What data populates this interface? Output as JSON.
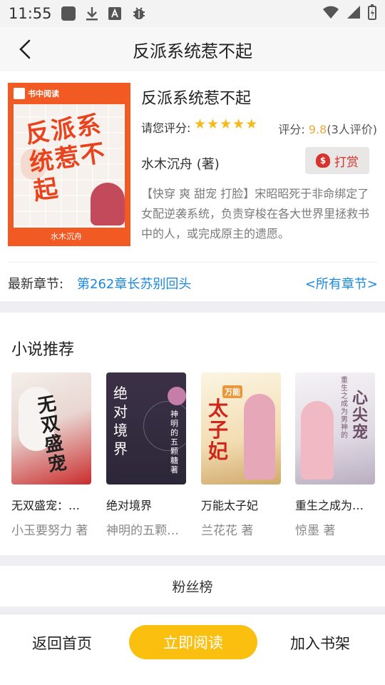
{
  "status": {
    "time": "11:55",
    "icons": [
      "app-square-icon",
      "download-icon",
      "font-a-icon",
      "bug-icon",
      "wifi-icon",
      "signal-icon",
      "battery-charging-icon"
    ]
  },
  "nav": {
    "title": "反派系统惹不起",
    "back_icon": "chevron-left-icon"
  },
  "book": {
    "title": "反派系统惹不起",
    "rate_label": "请您评分:",
    "stars": 5,
    "score_label": "评分:",
    "score_value": "9.8",
    "score_count": "(3人评价)",
    "author": "水木沉舟 (著)",
    "reward_label": "打赏",
    "description": "【快穿 爽 甜宠 打脸】宋昭昭死于非命绑定了女配逆袭系统，负责穿梭在各大世界里拯救书中的人，或完成原主的遗愿。",
    "cover": {
      "logo_text": "书中阅读",
      "title_text": "反派系统惹不起",
      "author_text": "水木沉舟"
    }
  },
  "chapters": {
    "latest_label": "最新章节:",
    "latest_chapter": "第262章长苏别回头",
    "all_label": "<所有章节>"
  },
  "recommend": {
    "title": "小说推荐",
    "items": [
      {
        "name": "无双盛宠：…",
        "author": "小玉要努力 著",
        "cover_text": "无双盛宠"
      },
      {
        "name": "绝对境界",
        "author": "神明的五颗…",
        "cover_text": "绝对境界",
        "cover_sub": "神明的五颗糖 著"
      },
      {
        "name": "万能太子妃",
        "author": "兰花花 著",
        "cover_text": "太子妃",
        "cover_small": "万能"
      },
      {
        "name": "重生之成为…",
        "author": "惊墨 著",
        "cover_text": "心尖宠",
        "cover_small": "重生之成为男神的"
      }
    ]
  },
  "fans": {
    "label": "粉丝榜"
  },
  "bottom": {
    "home": "返回首页",
    "read": "立即阅读",
    "shelf": "加入书架"
  },
  "colors": {
    "accent": "#fbbf0f",
    "link": "#1a89e0",
    "star": "#f6b91a",
    "score": "#f1a73a",
    "reward": "#d8322c"
  }
}
